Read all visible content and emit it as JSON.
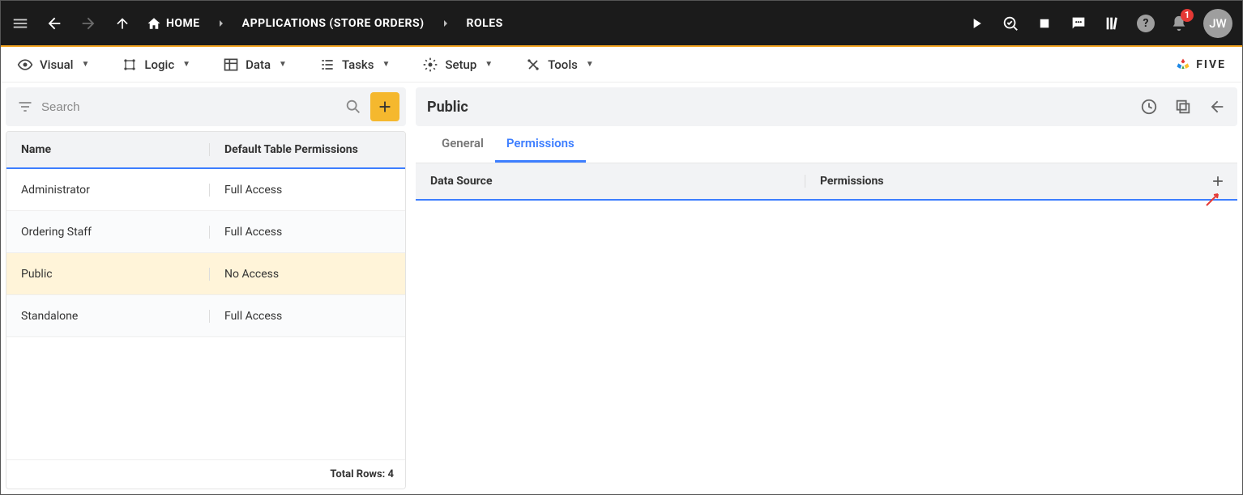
{
  "breadcrumb": {
    "home": "HOME",
    "app": "APPLICATIONS (STORE ORDERS)",
    "roles": "ROLES"
  },
  "notification_count": "1",
  "avatar_initials": "JW",
  "menu": {
    "visual": "Visual",
    "logic": "Logic",
    "data": "Data",
    "tasks": "Tasks",
    "setup": "Setup",
    "tools": "Tools"
  },
  "brand": "FIVE",
  "search": {
    "placeholder": "Search"
  },
  "grid": {
    "col1": "Name",
    "col2": "Default Table Permissions",
    "rows": [
      {
        "name": "Administrator",
        "perm": "Full Access"
      },
      {
        "name": "Ordering Staff",
        "perm": "Full Access"
      },
      {
        "name": "Public",
        "perm": "No Access"
      },
      {
        "name": "Standalone",
        "perm": "Full Access"
      }
    ],
    "footer": "Total Rows: 4",
    "selected_index": 2
  },
  "detail": {
    "title": "Public",
    "tabs": {
      "general": "General",
      "permissions": "Permissions"
    },
    "perm_head": {
      "col1": "Data Source",
      "col2": "Permissions"
    }
  }
}
